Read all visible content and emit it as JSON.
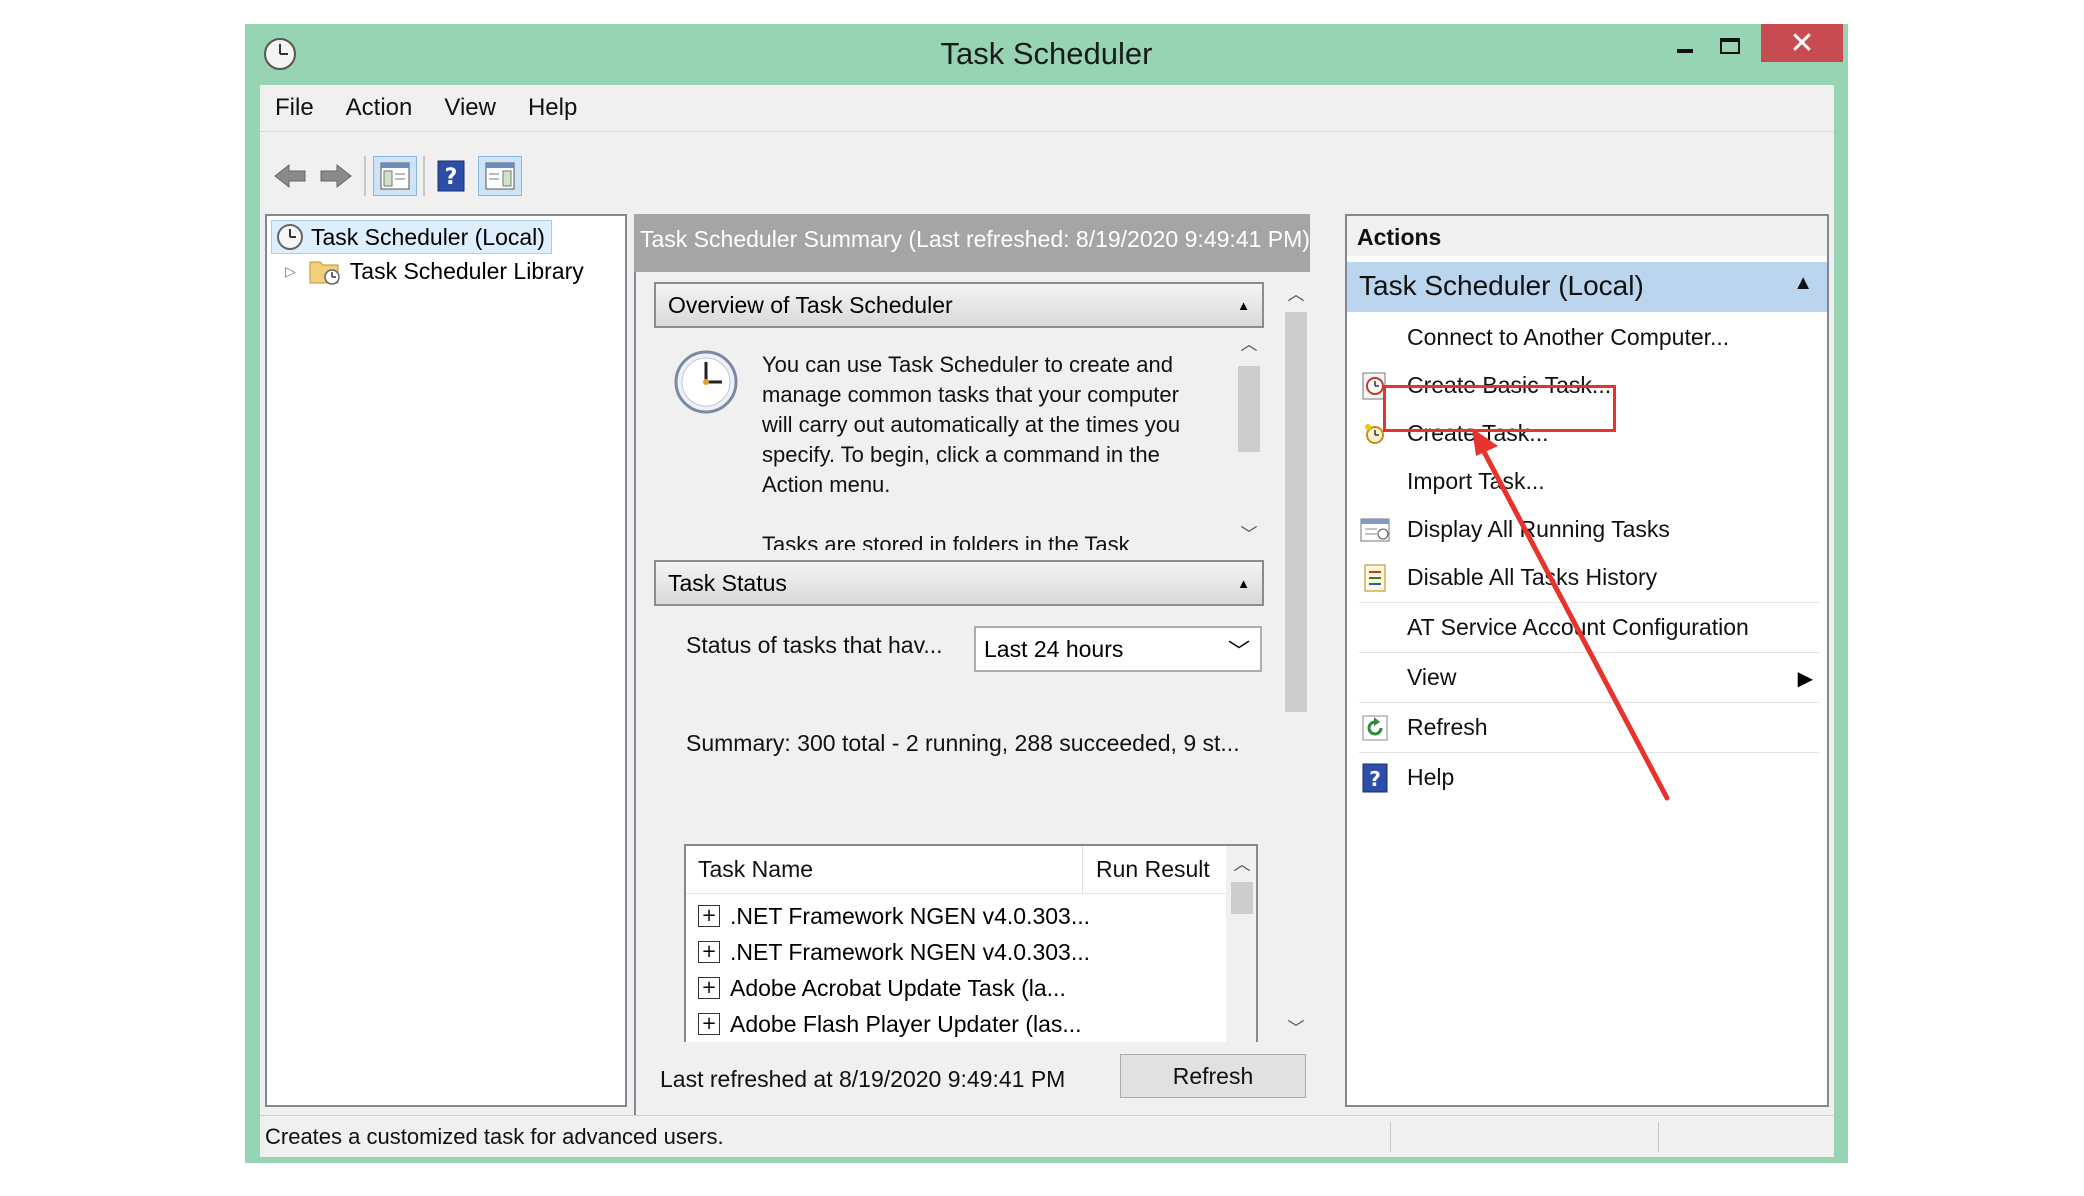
{
  "window": {
    "title": "Task Scheduler",
    "minimize_glyph": "–",
    "close_glyph": "✕"
  },
  "menubar": {
    "items": [
      "File",
      "Action",
      "View",
      "Help"
    ]
  },
  "tree": {
    "root": "Task Scheduler (Local)",
    "library": "Task Scheduler Library"
  },
  "center": {
    "header": "Task Scheduler Summary (Last refreshed: 8/19/2020 9:49:41 PM)",
    "overview": {
      "title": "Overview of Task Scheduler",
      "text": "You can use Task Scheduler to create and manage common tasks that your computer will carry out automatically at the times you specify. To begin, click a command in the Action menu.",
      "text2": "Tasks are stored in folders in the Task"
    },
    "task_status": {
      "title": "Task Status",
      "status_label": "Status of tasks that hav...",
      "dropdown_value": "Last 24 hours",
      "summary": "Summary: 300 total - 2 running, 288 succeeded, 9 st..."
    },
    "grid": {
      "col_name": "Task Name",
      "col_result": "Run Result",
      "rows": [
        ".NET Framework NGEN v4.0.303...",
        ".NET Framework NGEN v4.0.303...",
        "Adobe Acrobat Update Task (la...",
        "Adobe Flash Player Updater (las..."
      ]
    },
    "footer": {
      "last_refreshed": "Last refreshed at 8/19/2020 9:49:41 PM",
      "refresh_button": "Refresh"
    }
  },
  "actions": {
    "title": "Actions",
    "group": "Task Scheduler (Local)",
    "items": [
      {
        "label": "Connect to Another Computer...",
        "icon": "none"
      },
      {
        "label": "Create Basic Task...",
        "icon": "basic-task-icon"
      },
      {
        "label": "Create Task...",
        "icon": "create-task-icon"
      },
      {
        "label": "Import Task...",
        "icon": "none"
      },
      {
        "label": "Display All Running Tasks",
        "icon": "running-tasks-icon"
      },
      {
        "label": "Disable All Tasks History",
        "icon": "history-icon"
      },
      {
        "label": "AT Service Account Configuration",
        "icon": "none"
      },
      {
        "label": "View",
        "icon": "none"
      },
      {
        "label": "Refresh",
        "icon": "refresh-icon"
      },
      {
        "label": "Help",
        "icon": "help-icon"
      }
    ]
  },
  "statusbar": {
    "text": "Creates a customized task for advanced users."
  },
  "colors": {
    "window_frame": "#96d4b4",
    "close_button": "#c74b50",
    "selection": "#bcd5ee",
    "annotation": "#e8322c"
  }
}
